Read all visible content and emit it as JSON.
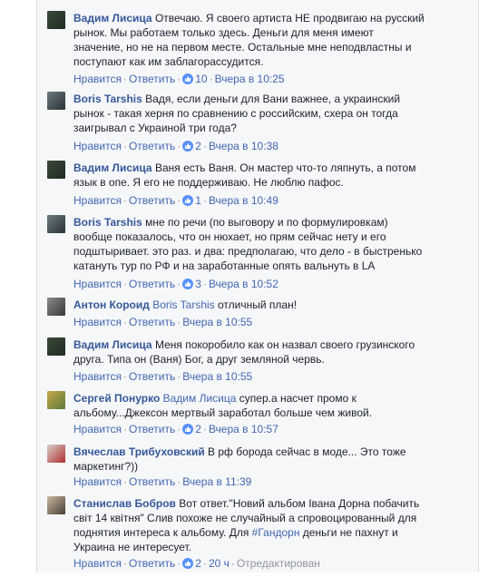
{
  "comments": [
    {
      "author": "Вадим Лисица",
      "mention": "",
      "lines": [
        "Отвечаю. Я своего артиста НЕ продвигаю на русский",
        "рынок. Мы работаем только здесь. Деньги для меня имеют",
        "значение, но не на первом месте. Остальные мне неподвластны и",
        "поступают как им заблагорассудится."
      ],
      "like_label": "Нравится",
      "reply_label": "Ответить",
      "likes": "10",
      "timestamp": "Вчера в 10:25",
      "edited": ""
    },
    {
      "author": "Boris Tarshis",
      "mention": "",
      "lines": [
        "Вадя, если деньги для Вани важнее, а украинский",
        "рынок - такая херня по сравнению с российским, схера он тогда",
        "заигрывал с Украиной три года?"
      ],
      "like_label": "Нравится",
      "reply_label": "Ответить",
      "likes": "2",
      "timestamp": "Вчера в 10:38",
      "edited": ""
    },
    {
      "author": "Вадим Лисица",
      "mention": "",
      "lines": [
        "Ваня есть Ваня. Он мастер что-то ляпнуть, а потом",
        "язык в опе. Я его не поддерживаю. Не люблю пафос."
      ],
      "like_label": "Нравится",
      "reply_label": "Ответить",
      "likes": "1",
      "timestamp": "Вчера в 10:49",
      "edited": ""
    },
    {
      "author": "Boris Tarshis",
      "mention": "",
      "lines": [
        "мне по речи (по выговору и по формулировкам)",
        "вообще показалось, что он нюхает, но прям сейчас нету и его",
        "подштыривает. это раз. и два: предполагаю, что дело - в быстренько",
        "катануть тур по РФ и на заработанные опять вальнуть в LA"
      ],
      "like_label": "Нравится",
      "reply_label": "Ответить",
      "likes": "3",
      "timestamp": "Вчера в 10:52",
      "edited": ""
    },
    {
      "author": "Антон Короид",
      "mention": "Boris Tarshis",
      "lines": [
        "отличный план!"
      ],
      "like_label": "Нравится",
      "reply_label": "Ответить",
      "likes": "",
      "timestamp": "Вчера в 10:55",
      "edited": ""
    },
    {
      "author": "Вадим Лисица",
      "mention": "",
      "lines": [
        "Меня покоробило как он назвал своего грузинского",
        "друга. Типа он (Ваня) Бог, а друг земляной червь."
      ],
      "like_label": "Нравится",
      "reply_label": "Ответить",
      "likes": "",
      "timestamp": "Вчера в 10:55",
      "edited": ""
    },
    {
      "author": "Сергей Понурко",
      "mention": "Вадим Лисица",
      "lines": [
        "супер.а насчет промо к",
        "альбому...Джексон мертвый заработал больше чем живой."
      ],
      "like_label": "Нравится",
      "reply_label": "Ответить",
      "likes": "2",
      "timestamp": "Вчера в 10:57",
      "edited": ""
    },
    {
      "author": "Вячеслав Трибуховский",
      "mention": "",
      "lines": [
        "В рф борода сейчас в моде... Это тоже",
        "маркетинг?))"
      ],
      "like_label": "Нравится",
      "reply_label": "Ответить",
      "likes": "",
      "timestamp": "Вчера в 11:39",
      "edited": ""
    },
    {
      "author": "Станислав Бобров",
      "mention": "",
      "lines": [
        "Вот ответ.\"Новий альбом Івана Дорна побачить",
        "світ 14 квітня\" Слив похоже не случайный а спровоцированный для",
        "поднятия интереса к альбому. Для #Гандорн деньги не пахнут и",
        "Украина не интересует."
      ],
      "hashtag": "#Гандорн",
      "like_label": "Нравится",
      "reply_label": "Ответить",
      "likes": "2",
      "timestamp": "20 ч",
      "edited": "Отредактирован"
    }
  ]
}
